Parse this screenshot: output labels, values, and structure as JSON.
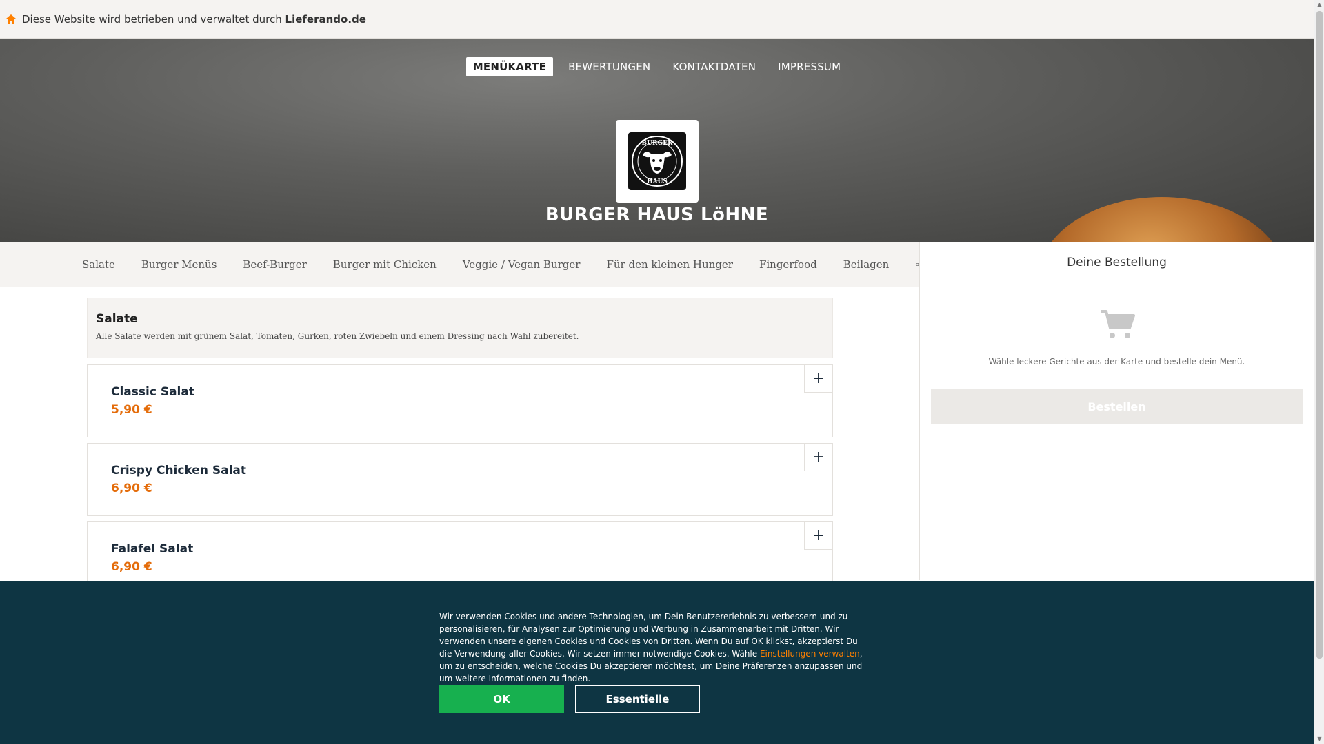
{
  "topbar": {
    "notice": "Diese Website wird betrieben und verwaltet durch ",
    "brand": "Lieferando.de"
  },
  "nav": {
    "tabs": [
      "MENÜKARTE",
      "BEWERTUNGEN",
      "KONTAKTDATEN",
      "IMPRESSUM"
    ],
    "active": "MENÜKARTE"
  },
  "restaurant": {
    "name": "BURGER HAUS LöHNE",
    "logo_text_top": "BURGER",
    "logo_text_bottom": "HAUS"
  },
  "categories": [
    "Salate",
    "Burger Menüs",
    "Beef-Burger",
    "Burger mit Chicken",
    "Veggie / Vegan Burger",
    "Für den kleinen Hunger",
    "Fingerfood",
    "Beilagen"
  ],
  "section": {
    "title": "Salate",
    "description": "Alle Salate werden mit grünem Salat, Tomaten, Gurken, roten Zwiebeln und einem Dressing nach Wahl zubereitet."
  },
  "items": [
    {
      "name": "Classic Salat",
      "price": "5,90 €"
    },
    {
      "name": "Crispy Chicken Salat",
      "price": "6,90 €"
    },
    {
      "name": "Falafel Salat",
      "price": "6,90 €"
    }
  ],
  "add_label": "+",
  "basket": {
    "title": "Deine Bestellung",
    "empty_text": "Wähle leckere Gerichte aus der Karte und bestelle dein Menü.",
    "order_button": "Bestellen"
  },
  "cookie": {
    "text_before": "Wir verwenden Cookies und andere Technologien, um Dein Benutzererlebnis zu verbessern und zu personalisieren, für Analysen zur Optimierung und Werbung in Zusammenarbeit mit Dritten. Wir verwenden unsere eigenen Cookies und Cookies von Dritten. Wenn Du auf OK klickst, akzeptierst Du die Verwendung aller Cookies. Wir setzen immer notwendige Cookies. Wähle ",
    "link": "Einstellungen verwalten",
    "text_after": ", um zu entscheiden, welche Cookies Du akzeptieren möchtest, um Deine Präferenzen anzupassen und um weitere Informationen zu finden.",
    "ok_button": "OK",
    "essential_button": "Essentielle"
  },
  "colors": {
    "accent": "#e46c0a",
    "cookie_bg": "#0e3543",
    "ok_green": "#17b04f",
    "item_title": "#1d2b3a"
  },
  "icons": {
    "house": "house-icon",
    "cart": "shopping-cart-icon",
    "more": "more-categories-icon"
  }
}
